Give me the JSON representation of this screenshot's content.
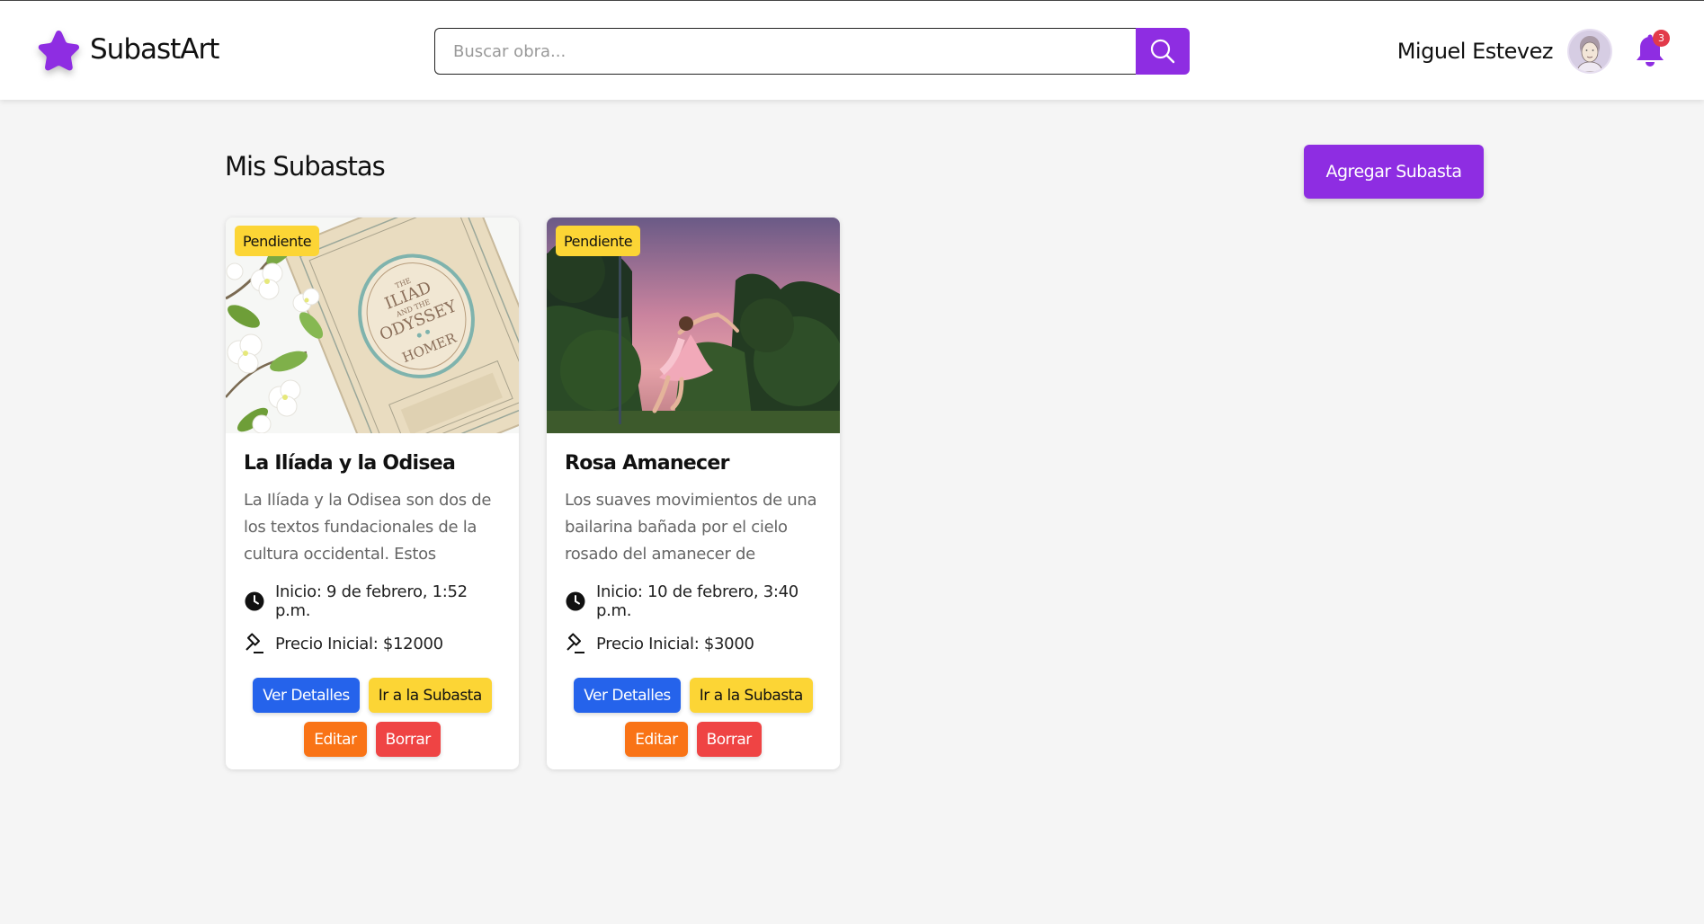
{
  "brand": {
    "name": "SubastArt",
    "accent": "#8e2de2",
    "logo_icon": "star-icon"
  },
  "search": {
    "placeholder": "Buscar obra...",
    "icon": "search-icon"
  },
  "user": {
    "name": "Miguel Estevez",
    "notifications_count": "3"
  },
  "page": {
    "title": "Mis Subastas",
    "add_label": "Agregar Subasta"
  },
  "auctions": [
    {
      "status": "Pendiente",
      "title": "La Ilíada y la Odisea",
      "description": "La Ilíada y la Odisea son dos de los textos fundacionales de la cultura occidental. Estos poemas épicos...",
      "start": "Inicio: 9 de febrero, 1:52 p.m.",
      "price": "Precio Inicial: $12000",
      "image_book": {
        "line1": "THE",
        "line2": "ILIAD",
        "line3": "AND THE",
        "line4": "ODYSSEY",
        "line5": "HOMER"
      },
      "buttons": {
        "details": "Ver Detalles",
        "go": "Ir a la Subasta",
        "edit": "Editar",
        "delete": "Borrar"
      }
    },
    {
      "status": "Pendiente",
      "title": "Rosa Amanecer",
      "description": "Los suaves movimientos de una bailarina bañada por el cielo rosado del amanecer de Diciembre",
      "start": "Inicio: 10 de febrero, 3:40 p.m.",
      "price": "Precio Inicial: $3000",
      "buttons": {
        "details": "Ver Detalles",
        "go": "Ir a la Subasta",
        "edit": "Editar",
        "delete": "Borrar"
      }
    }
  ],
  "colors": {
    "status_badge": "#fcd535",
    "details_button": "#2563eb",
    "go_button": "#fcd535",
    "edit_button": "#f97316",
    "delete_button": "#ef4444"
  }
}
